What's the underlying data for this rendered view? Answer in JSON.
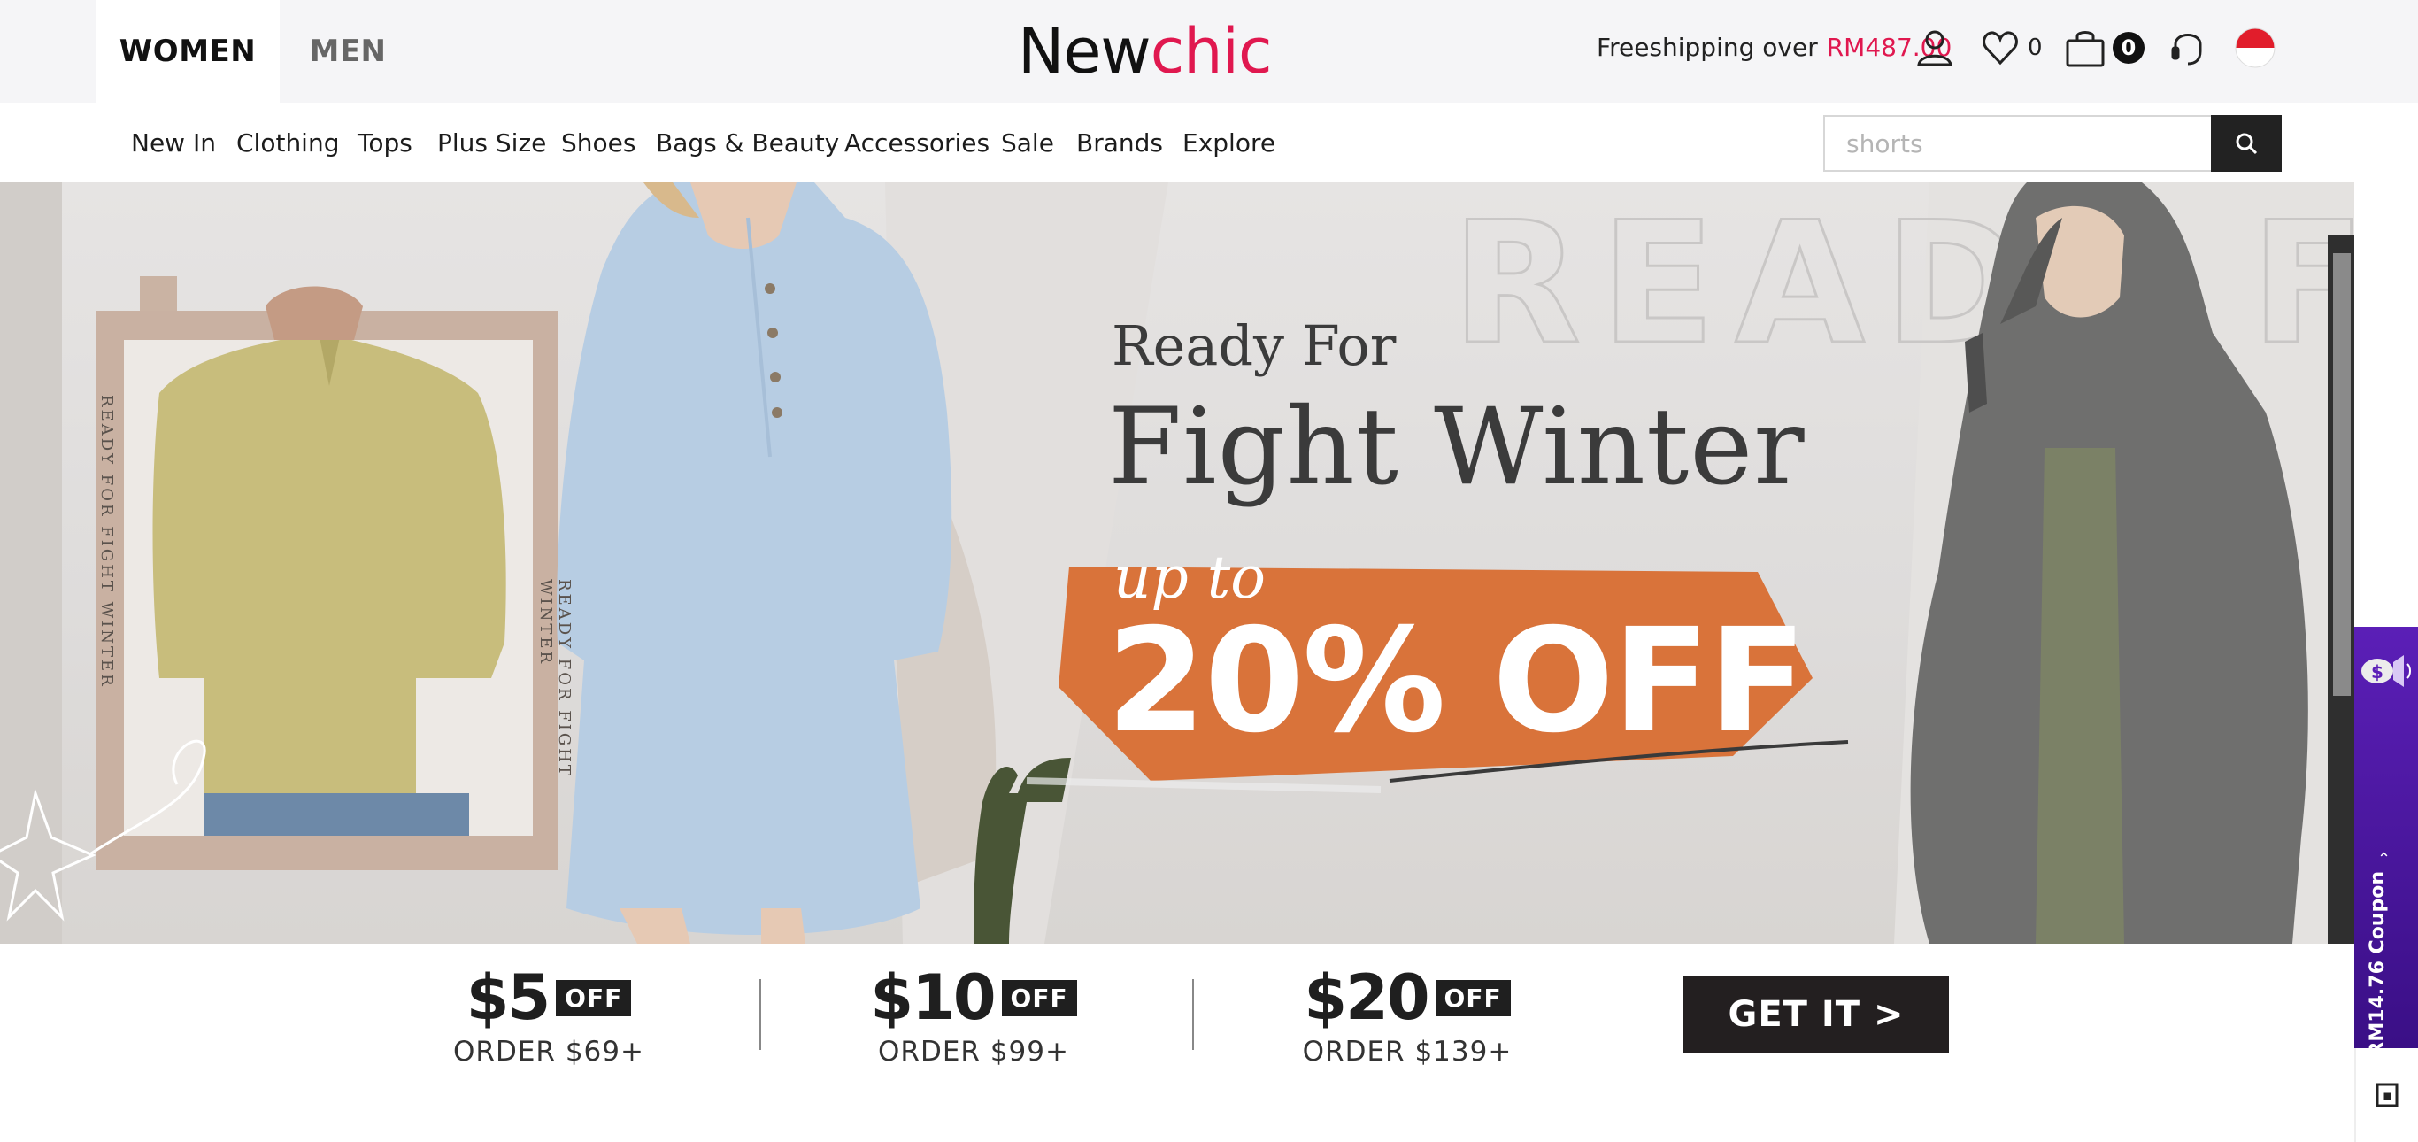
{
  "header": {
    "tabs": [
      {
        "label": "WOMEN",
        "active": true
      },
      {
        "label": "MEN",
        "active": false
      }
    ],
    "logo": {
      "part1": "New",
      "part2": "chic"
    },
    "shipping": {
      "text": "Freeshipping over",
      "amount": "RM487.00"
    },
    "wishlist_count": "0",
    "cart_count": "0",
    "icons": [
      "user-icon",
      "heart-icon",
      "bag-icon",
      "headset-icon",
      "flag-indonesia-icon"
    ]
  },
  "nav": {
    "items": [
      "New In",
      "Clothing",
      "Tops",
      "Plus Size",
      "Shoes",
      "Bags & Beauty",
      "Accessories",
      "Sale",
      "Brands",
      "Explore"
    ]
  },
  "search": {
    "placeholder": "shorts"
  },
  "banner": {
    "line1": "Ready For",
    "line2": "Fight Winter",
    "script": "up to",
    "discount": "20% OFF",
    "watermark": "READY FOR",
    "side_text": "READY FOR FIGHT WINTER"
  },
  "coupons": {
    "items": [
      {
        "amount": "$5",
        "tag": "OFF",
        "order": "ORDER $69+"
      },
      {
        "amount": "$10",
        "tag": "OFF",
        "order": "ORDER $99+"
      },
      {
        "amount": "$20",
        "tag": "OFF",
        "order": "ORDER $139+"
      }
    ],
    "cta": "GET IT >"
  },
  "side_coupon": {
    "label": "RM14.76 Coupon"
  },
  "colors": {
    "brand": "#e0184f",
    "banner_orange": "#d9733a",
    "side_purple": "#4b16a0"
  }
}
